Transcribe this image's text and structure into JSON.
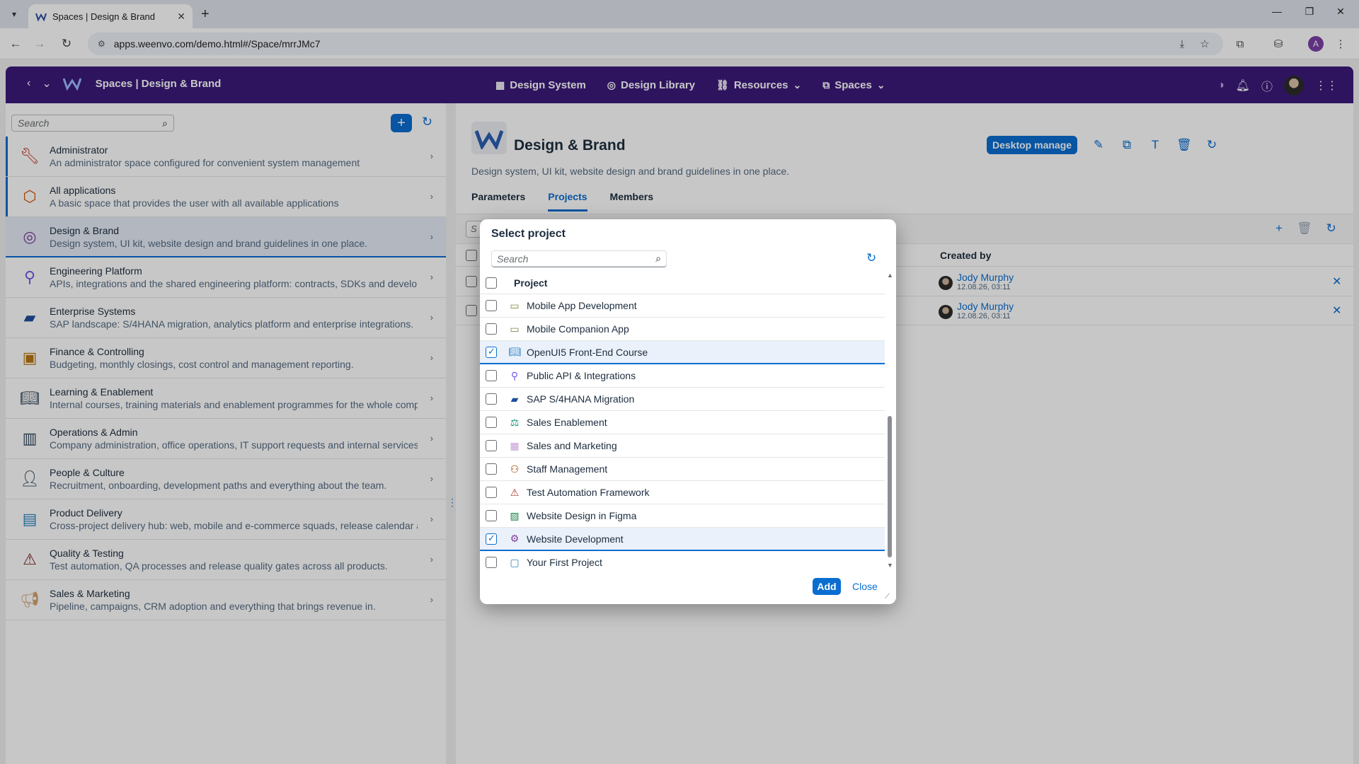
{
  "browser": {
    "tab_title": "Spaces | Design & Brand",
    "url": "apps.weenvo.com/demo.html#/Space/mrrJMc7",
    "profile_initial": "A"
  },
  "shellbar": {
    "title": "Spaces | Design & Brand",
    "menu": [
      {
        "label": "Design System",
        "icon": "grid-icon"
      },
      {
        "label": "Design Library",
        "icon": "palette-icon"
      },
      {
        "label": "Resources",
        "icon": "link-icon"
      },
      {
        "label": "Spaces",
        "icon": "spaces-icon"
      }
    ]
  },
  "left": {
    "search_placeholder": "Search",
    "items": [
      {
        "title": "Administrator",
        "desc": "An administrator space configured for convenient system management",
        "icon": "wrench-icon",
        "color": "#c0392b"
      },
      {
        "title": "All applications",
        "desc": "A basic space that provides the user with all available applications",
        "icon": "cube-icon",
        "color": "#d35400"
      },
      {
        "title": "Design & Brand",
        "desc": "Design system, UI kit, website design and brand guidelines in one place.",
        "icon": "palette-icon",
        "color": "#7d3c98"
      },
      {
        "title": "Engineering Platform",
        "desc": "APIs, integrations and the shared engineering platform: contracts, SDKs and develop",
        "icon": "plug-icon",
        "color": "#6c5ce7"
      },
      {
        "title": "Enterprise Systems",
        "desc": "SAP landscape: S/4HANA migration, analytics platform and enterprise integrations.",
        "icon": "flag-icon",
        "color": "#1f4e9e"
      },
      {
        "title": "Finance & Controlling",
        "desc": "Budgeting, monthly closings, cost control and management reporting.",
        "icon": "money-icon",
        "color": "#b9770e"
      },
      {
        "title": "Learning & Enablement",
        "desc": "Internal courses, training materials and enablement programmes for the whole comp",
        "icon": "book-icon",
        "color": "#34495e"
      },
      {
        "title": "Operations & Admin",
        "desc": "Company administration, office operations, IT support requests and internal services.",
        "icon": "building-icon",
        "color": "#34495e"
      },
      {
        "title": "People & Culture",
        "desc": "Recruitment, onboarding, development paths and everything about the team.",
        "icon": "person-icon",
        "color": "#34495e"
      },
      {
        "title": "Product Delivery",
        "desc": "Cross-project delivery hub: web, mobile and e-commerce squads, release calendar a",
        "icon": "factory-icon",
        "color": "#2e86c1"
      },
      {
        "title": "Quality & Testing",
        "desc": "Test automation, QA processes and release quality gates across all products.",
        "icon": "warning-icon",
        "color": "#7b241c"
      },
      {
        "title": "Sales & Marketing",
        "desc": "Pipeline, campaigns, CRM adoption and everything that brings revenue in.",
        "icon": "megaphone-icon",
        "color": "#d4a373"
      }
    ]
  },
  "space": {
    "title": "Design & Brand",
    "description": "Design system, UI kit, website design and brand guidelines in one place.",
    "desktop_manage": "Desktop manage",
    "tabs": [
      "Parameters",
      "Projects",
      "Members"
    ],
    "search_placeholder": "S",
    "created_by_header": "Created by",
    "rows": [
      {
        "name": "Jody Murphy",
        "date": "12.08.26, 03:11"
      },
      {
        "name": "Jody Murphy",
        "date": "12.08.26, 03:11"
      }
    ]
  },
  "dialog": {
    "title": "Select project",
    "search_placeholder": "Search",
    "column": "Project",
    "projects": [
      {
        "name": "Mobile App Development",
        "checked": false,
        "icon": "devices-icon",
        "color": "#7a8a3c"
      },
      {
        "name": "Mobile Companion App",
        "checked": false,
        "icon": "devices-icon",
        "color": "#7a8a3c"
      },
      {
        "name": "OpenUI5 Front-End Course",
        "checked": true,
        "icon": "book-icon",
        "color": "#2e86c1"
      },
      {
        "name": "Public API & Integrations",
        "checked": false,
        "icon": "plug-icon",
        "color": "#6c5ce7"
      },
      {
        "name": "SAP S/4HANA Migration",
        "checked": false,
        "icon": "flag-icon",
        "color": "#1f4e9e"
      },
      {
        "name": "Sales Enablement",
        "checked": false,
        "icon": "scale-icon",
        "color": "#148f77"
      },
      {
        "name": "Sales and Marketing",
        "checked": false,
        "icon": "chart-icon",
        "color": "#c39bd3"
      },
      {
        "name": "Staff Management",
        "checked": false,
        "icon": "people-icon",
        "color": "#a04000"
      },
      {
        "name": "Test Automation Framework",
        "checked": false,
        "icon": "warning-icon",
        "color": "#b03a2e"
      },
      {
        "name": "Website Design in Figma",
        "checked": false,
        "icon": "image-icon",
        "color": "#1e8449"
      },
      {
        "name": "Website Development",
        "checked": true,
        "icon": "gear-icon",
        "color": "#7d3c98"
      },
      {
        "name": "Your First Project",
        "checked": false,
        "icon": "briefcase-icon",
        "color": "#2e86c1"
      }
    ],
    "add_label": "Add",
    "close_label": "Close"
  }
}
